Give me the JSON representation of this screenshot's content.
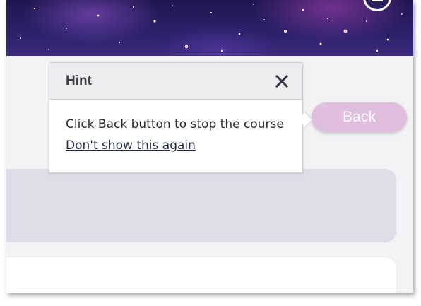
{
  "hint": {
    "title": "Hint",
    "message": "Click Back button to stop the course",
    "dont_show_link": "Don't show this again"
  },
  "back_button": {
    "label": "Back"
  },
  "icons": {
    "close": "close-icon",
    "avatar": "avatar"
  },
  "colors": {
    "back_button_bg": "#e0bedd",
    "hint_header_bg": "#eeeef0",
    "lilac_card": "#e1dde8",
    "page_bg": "#f3f3f6",
    "banner": "#2b1f68"
  }
}
